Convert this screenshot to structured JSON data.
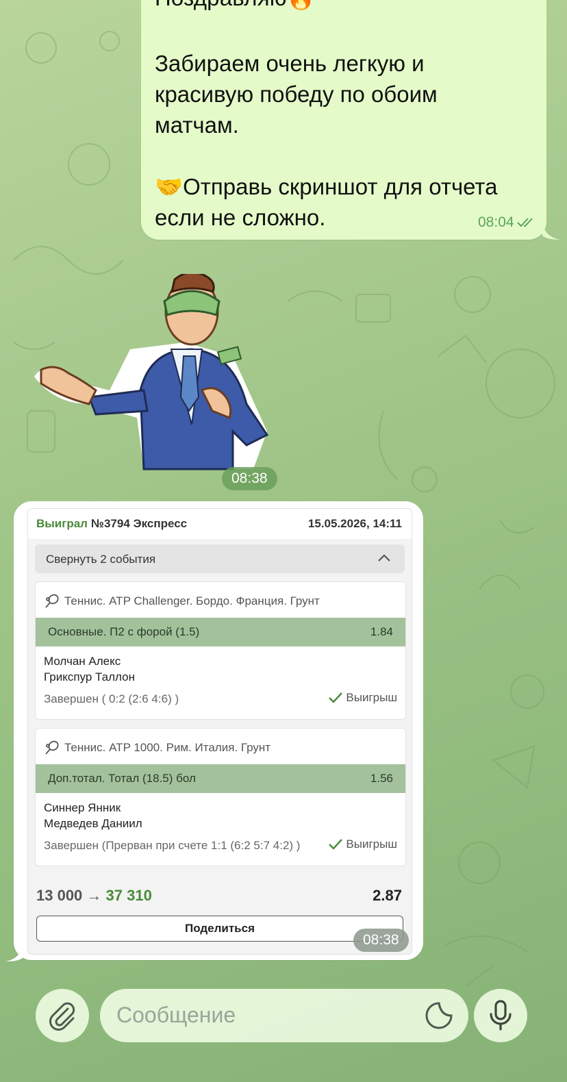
{
  "chat": {
    "outgoing": {
      "header": "Поздравляю🔥",
      "text": "Забираем очень легкую и\nкрасивую победу по обоим\nматчам.\n\n🤝Отправь скриншот для отчета\nесли не сложно.",
      "time": "08:04",
      "status_icon": "double-check-icon"
    },
    "sticker": {
      "time": "08:38"
    },
    "incoming": {
      "time": "08:38",
      "bet": {
        "status": "Выиграл",
        "number": "№3794 Экспресс",
        "date": "15.05.2026, 14:11",
        "collapse_label": "Свернуть 2 события",
        "events": [
          {
            "sport": "Теннис. ATP Challenger. Бордо. Франция. Грунт",
            "market": "Основные. П2 с форой (1.5)",
            "odds": "1.84",
            "team1": "Молчан Алекс",
            "team2": "Грикспур Таллон",
            "status": "Завершен ( 0:2 (2:6 4:6) )",
            "result": "Выигрыш"
          },
          {
            "sport": "Теннис. ATP 1000. Рим. Италия. Грунт",
            "market": "Доп.тотал. Тотал (18.5) бол",
            "odds": "1.56",
            "team1": "Синнер Янник",
            "team2": "Медведев Даниил",
            "status": "Завершен (Прерван при счете 1:1 (6:2 5:7 4:2) )",
            "result": "Выигрыш"
          }
        ],
        "stake": "13 000",
        "arrow": "→",
        "payout": "37 310",
        "coefficient": "2.87",
        "share_label": "Поделиться"
      }
    }
  },
  "composer": {
    "placeholder": "Сообщение",
    "attach_icon": "paperclip-icon",
    "sticker_icon": "sticker-icon",
    "mic_icon": "microphone-icon"
  },
  "colors": {
    "outgoing_bubble": "#e4fbc9",
    "win_green": "#4a8a3a",
    "market_bar": "#a3c29c"
  }
}
